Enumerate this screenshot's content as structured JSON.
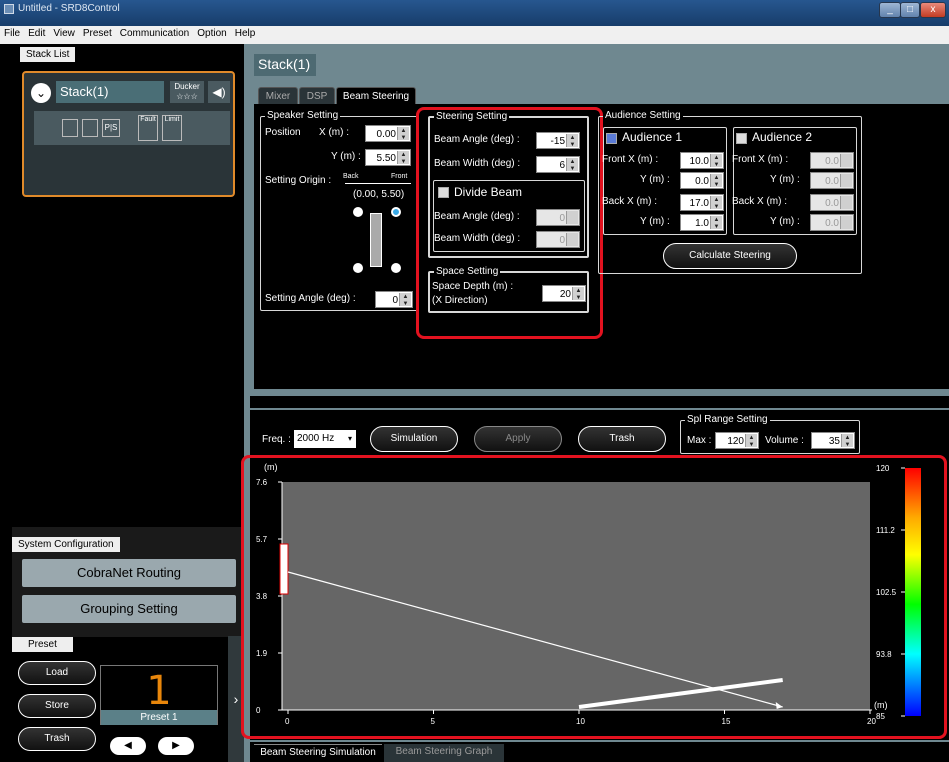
{
  "window": {
    "title": "Untitled - SRD8Control",
    "min": "_",
    "max": "□",
    "close": "x"
  },
  "menu": [
    "File",
    "Edit",
    "View",
    "Preset",
    "Communication",
    "Option",
    "Help"
  ],
  "stack_list": {
    "tab": "Stack List",
    "stack_name": "Stack(1)",
    "ducker": "Ducker",
    "ducker_stars": "☆☆☆",
    "fault": "Fault",
    "limit": "Limit"
  },
  "system_configuration": {
    "tab": "System Configuration",
    "cobranet": "CobraNet Routing",
    "grouping": "Grouping Setting"
  },
  "preset": {
    "tab": "Preset",
    "load": "Load",
    "store": "Store",
    "trash": "Trash",
    "number": "1",
    "name": "Preset 1"
  },
  "main": {
    "stack_title": "Stack(1)",
    "tabs": [
      "Mixer",
      "DSP",
      "Beam Steering"
    ]
  },
  "speaker_setting": {
    "title": "Speaker Setting",
    "position": "Position",
    "x_label": "X (m) :",
    "x_value": "0.00",
    "y_label": "Y (m) :",
    "y_value": "5.50",
    "origin_label": "Setting Origin :",
    "back": "Back",
    "front": "Front",
    "origin_coords": "(0.00, 5.50)",
    "angle_label": "Setting Angle (deg) :",
    "angle_value": "0"
  },
  "steering_setting": {
    "title": "Steering Setting",
    "beam_angle_label": "Beam Angle (deg) :",
    "beam_angle": "-15",
    "beam_width_label": "Beam Width (deg) :",
    "beam_width": "6",
    "divide_beam": "Divide Beam",
    "div_angle_label": "Beam Angle (deg) :",
    "div_angle": "0",
    "div_width_label": "Beam Width (deg) :",
    "div_width": "0"
  },
  "space_setting": {
    "title": "Space Setting",
    "depth_label": "Space Depth (m) :",
    "depth_sub": "(X Direction)",
    "depth_value": "20"
  },
  "audience_setting": {
    "title": "Audience Setting",
    "a1": "Audience 1",
    "a2": "Audience 2",
    "front_x": "Front  X (m) :",
    "y": "Y (m) :",
    "back_x": "Back  X (m) :",
    "a1_fx": "10.0",
    "a1_fy": "0.0",
    "a1_bx": "17.0",
    "a1_by": "1.0",
    "a2_fx": "0.0",
    "a2_fy": "0.0",
    "a2_bx": "0.0",
    "a2_by": "0.0",
    "calculate": "Calculate Steering"
  },
  "simulation": {
    "freq_label": "Freq. :",
    "freq_value": "2000 Hz",
    "simulation": "Simulation",
    "apply": "Apply",
    "trash": "Trash",
    "spl_title": "Spl Range Setting",
    "max_label": "Max :",
    "max_value": "120",
    "volume_label": "Volume :",
    "volume_value": "35"
  },
  "chart_data": {
    "type": "line",
    "xlabel": "(m)",
    "ylabel": "(m)",
    "x_ticks": [
      "0",
      "5",
      "10",
      "15",
      "20"
    ],
    "y_ticks": [
      "7.6",
      "5.7",
      "3.8",
      "1.9",
      "0"
    ],
    "xlim": [
      0,
      20
    ],
    "ylim": [
      0,
      7.6
    ],
    "series": [
      {
        "values": [
          [
            0,
            4.6
          ],
          [
            17,
            0.1
          ]
        ]
      },
      {
        "values": [
          [
            10,
            0.1
          ],
          [
            17,
            1.0
          ]
        ]
      }
    ],
    "colorbar_ticks": [
      "120",
      "111.2",
      "102.5",
      "93.8",
      "85"
    ]
  },
  "bottom_tabs": [
    "Beam Steering Simulation",
    "Beam Steering Graph"
  ]
}
